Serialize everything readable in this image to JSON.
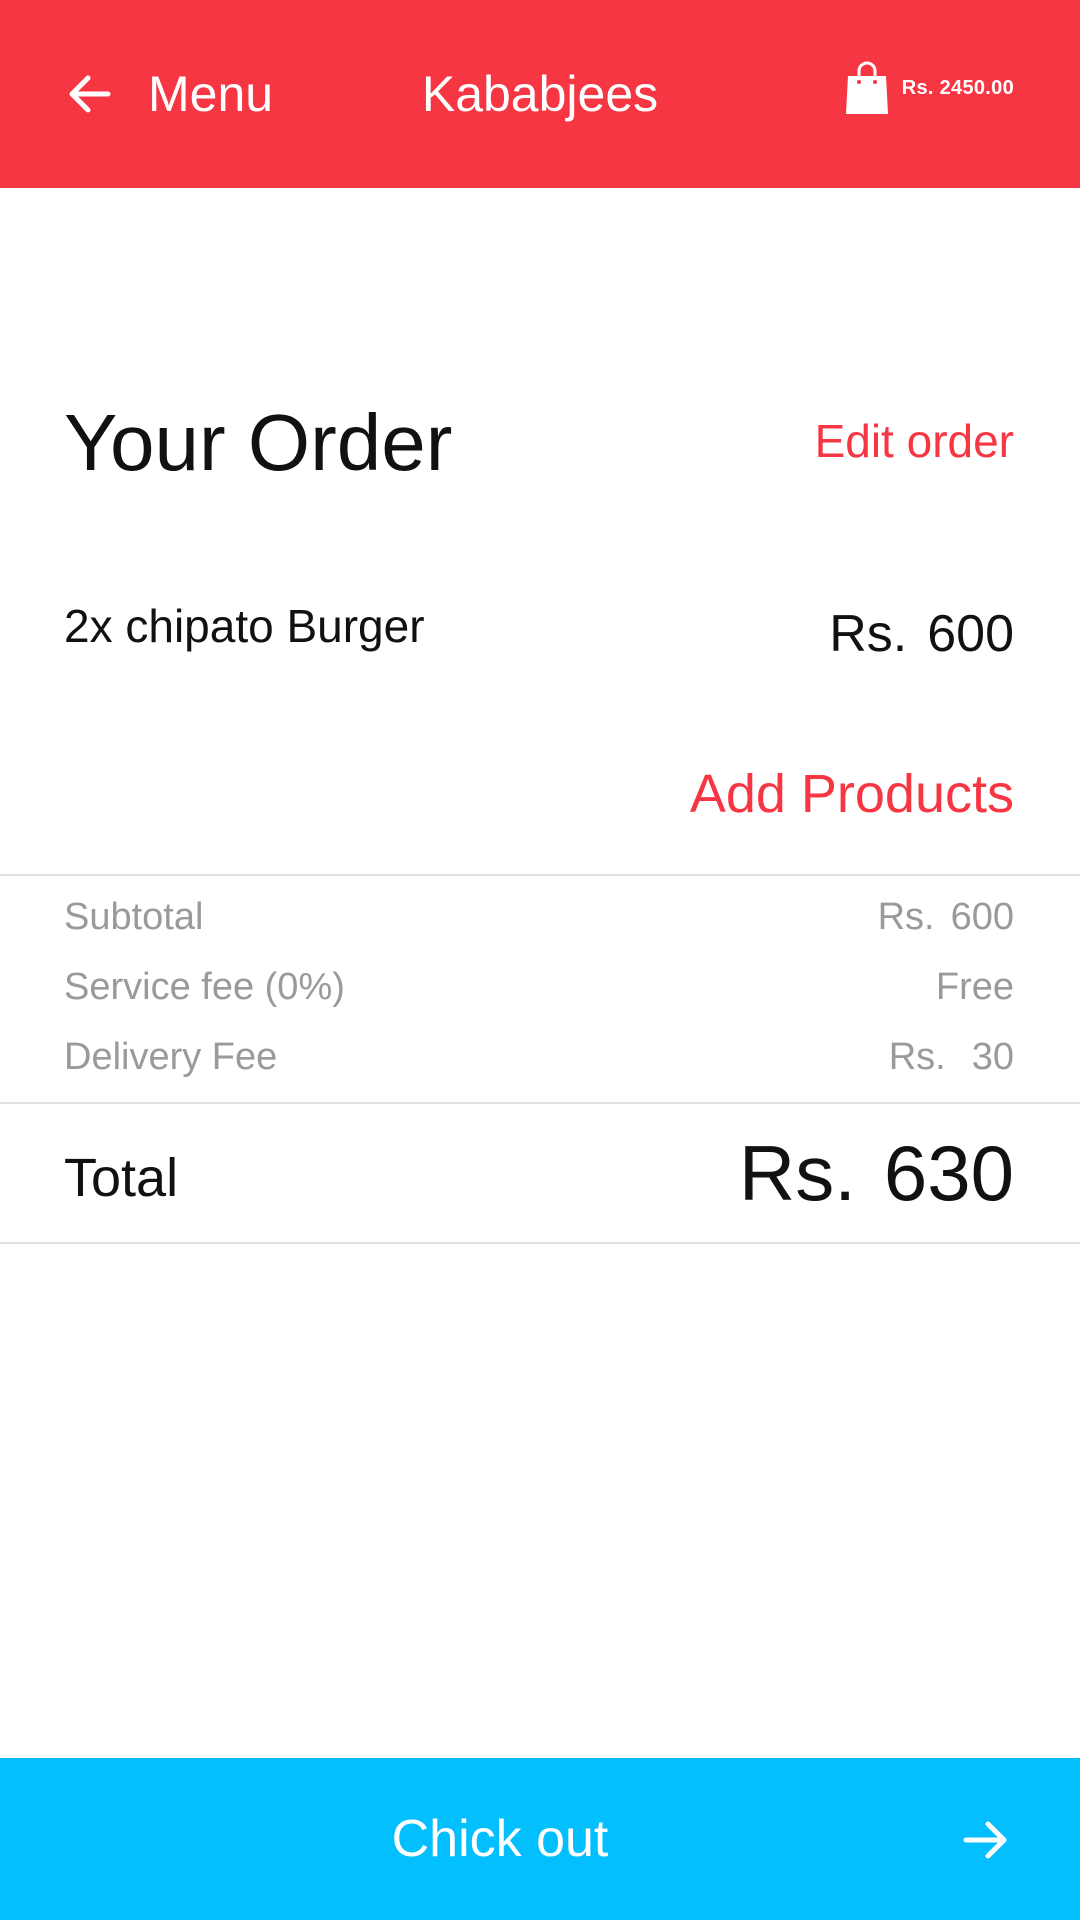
{
  "header": {
    "back_icon": "arrow-left-icon",
    "menu_label": "Menu",
    "title": "Kababjees",
    "cart_icon": "shopping-bag-icon",
    "cart_total": "Rs. 2450.00",
    "color": "#f73643"
  },
  "order": {
    "title": "Your Order",
    "edit_label": "Edit order",
    "items": [
      {
        "name": "2x chipato Burger",
        "currency": "Rs.",
        "amount": "600"
      }
    ],
    "add_products_label": "Add Products"
  },
  "summary": {
    "subtotal": {
      "label": "Subtotal",
      "currency": "Rs.",
      "amount": "600"
    },
    "service_fee": {
      "label": "Service fee (0%)",
      "value": "Free"
    },
    "delivery_fee": {
      "label": "Delivery Fee",
      "currency": "Rs.",
      "amount": "30"
    },
    "total": {
      "label": "Total",
      "currency": "Rs.",
      "amount": "630"
    }
  },
  "checkout": {
    "label": "Chick out",
    "arrow_icon": "arrow-right-icon",
    "color": "#04bffd"
  },
  "colors": {
    "accent": "#f73643",
    "checkout": "#04bffd",
    "muted_text": "#9a9a9a",
    "primary_text": "#111111"
  }
}
